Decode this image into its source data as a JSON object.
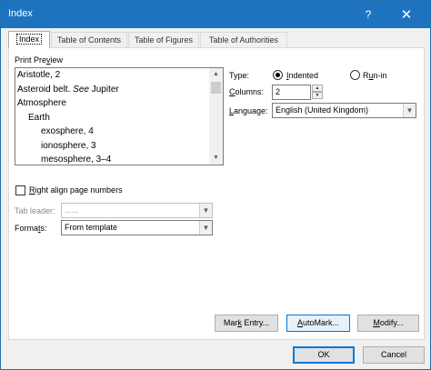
{
  "window": {
    "title": "Index",
    "help_glyph": "?",
    "close_glyph": "✕"
  },
  "tabs": [
    {
      "label": "Index",
      "active": true
    },
    {
      "label": "Table of Contents"
    },
    {
      "label": "Table of Figures"
    },
    {
      "label": "Table of Authorities"
    }
  ],
  "preview": {
    "label": "Print Preview",
    "lines": [
      {
        "text": "Aristotle, 2"
      },
      {
        "before": "Asteroid belt. ",
        "italic": "See",
        "after": " Jupiter"
      },
      {
        "text": "Atmosphere"
      },
      {
        "text": "Earth"
      },
      {
        "text": "exosphere, 4"
      },
      {
        "text": "ionosphere, 3"
      },
      {
        "text": "mesosphere, 3–4"
      }
    ]
  },
  "right_align": {
    "label": "Right align page numbers",
    "checked": false
  },
  "tab_leader": {
    "label": "Tab leader:",
    "value": "......"
  },
  "formats": {
    "label": "Formats:",
    "value": "From template"
  },
  "type": {
    "label": "Type:",
    "options": [
      "Indented",
      "Run-in"
    ],
    "selected": "Indented"
  },
  "columns": {
    "label": "Columns:",
    "value": "2"
  },
  "language": {
    "label": "Language:",
    "value": "English (United Kingdom)"
  },
  "buttons": {
    "mark_entry": "Mark Entry...",
    "automark": "AutoMark...",
    "modify": "Modify...",
    "ok": "OK",
    "cancel": "Cancel"
  }
}
